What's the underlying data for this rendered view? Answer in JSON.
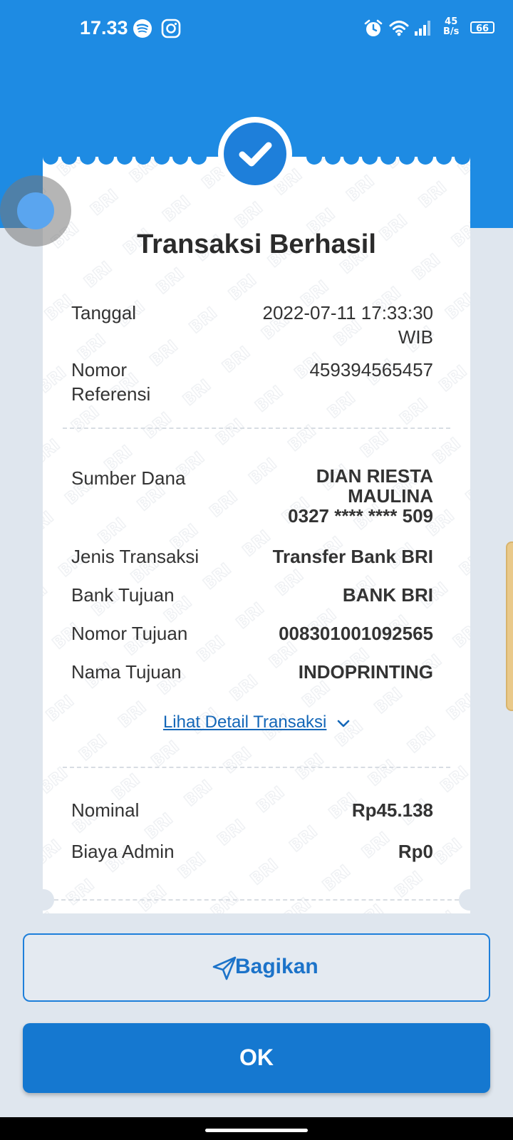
{
  "status_bar": {
    "time": "17.33",
    "net_speed_value": "45",
    "net_speed_unit": "B/s",
    "battery": "66"
  },
  "receipt": {
    "title": "Transaksi Berhasil",
    "tanggal_label": "Tanggal",
    "tanggal_value_line1": "2022-07-11 17:33:30",
    "tanggal_value_line2": "WIB",
    "nomor_referensi_label_line1": "Nomor",
    "nomor_referensi_label_line2": "Referensi",
    "nomor_referensi_value": "459394565457",
    "sumber_dana_label": "Sumber Dana",
    "sumber_dana_name_line1": "DIAN RIESTA",
    "sumber_dana_name_line2": "MAULINA",
    "sumber_dana_account": "0327 **** **** 509",
    "jenis_transaksi_label": "Jenis Transaksi",
    "jenis_transaksi_value": "Transfer Bank BRI",
    "bank_tujuan_label": "Bank Tujuan",
    "bank_tujuan_value": "BANK BRI",
    "nomor_tujuan_label": "Nomor Tujuan",
    "nomor_tujuan_value": "008301001092565",
    "nama_tujuan_label": "Nama Tujuan",
    "nama_tujuan_value": "INDOPRINTING",
    "detail_link": "Lihat Detail Transaksi",
    "nominal_label": "Nominal",
    "nominal_value": "Rp45.138",
    "biaya_admin_label": "Biaya Admin",
    "biaya_admin_value": "Rp0",
    "watermark": "BRI"
  },
  "actions": {
    "share_label": "Bagikan",
    "ok_label": "OK"
  },
  "colors": {
    "primary": "#1e8be3",
    "button": "#1578d0",
    "link": "#1467b8",
    "background": "#dfe6ee"
  }
}
